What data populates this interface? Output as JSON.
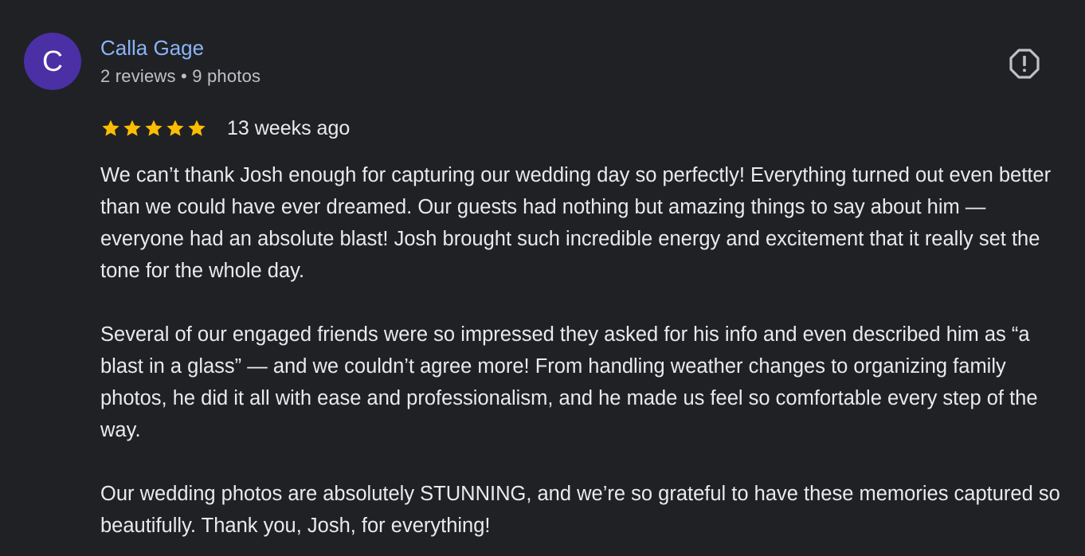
{
  "reviewer": {
    "initial": "C",
    "name": "Calla Gage",
    "meta": "2 reviews • 9 photos",
    "avatar_color": "#4b2fa5"
  },
  "report_icon": "report-flag-icon",
  "rating": {
    "stars": 5,
    "star_color": "#fbbc04",
    "time_ago": "13 weeks ago"
  },
  "review": {
    "paragraphs": [
      "We can’t thank Josh enough for capturing our wedding day so perfectly! Everything turned out even better than we could have ever dreamed. Our guests had nothing but amazing things to say about him — everyone had an absolute blast! Josh brought such incredible energy and excitement that it really set the tone for the whole day.",
      "Several of our engaged friends were so impressed they asked for his info and even described him as “a blast in a glass” — and we couldn’t agree more! From handling weather changes to organizing family photos, he did it all with ease and professionalism, and he made us feel so comfortable every step of the way.",
      "Our wedding photos are absolutely STUNNING, and we’re so grateful to have these memories captured so beautifully. Thank you, Josh, for everything!"
    ]
  }
}
